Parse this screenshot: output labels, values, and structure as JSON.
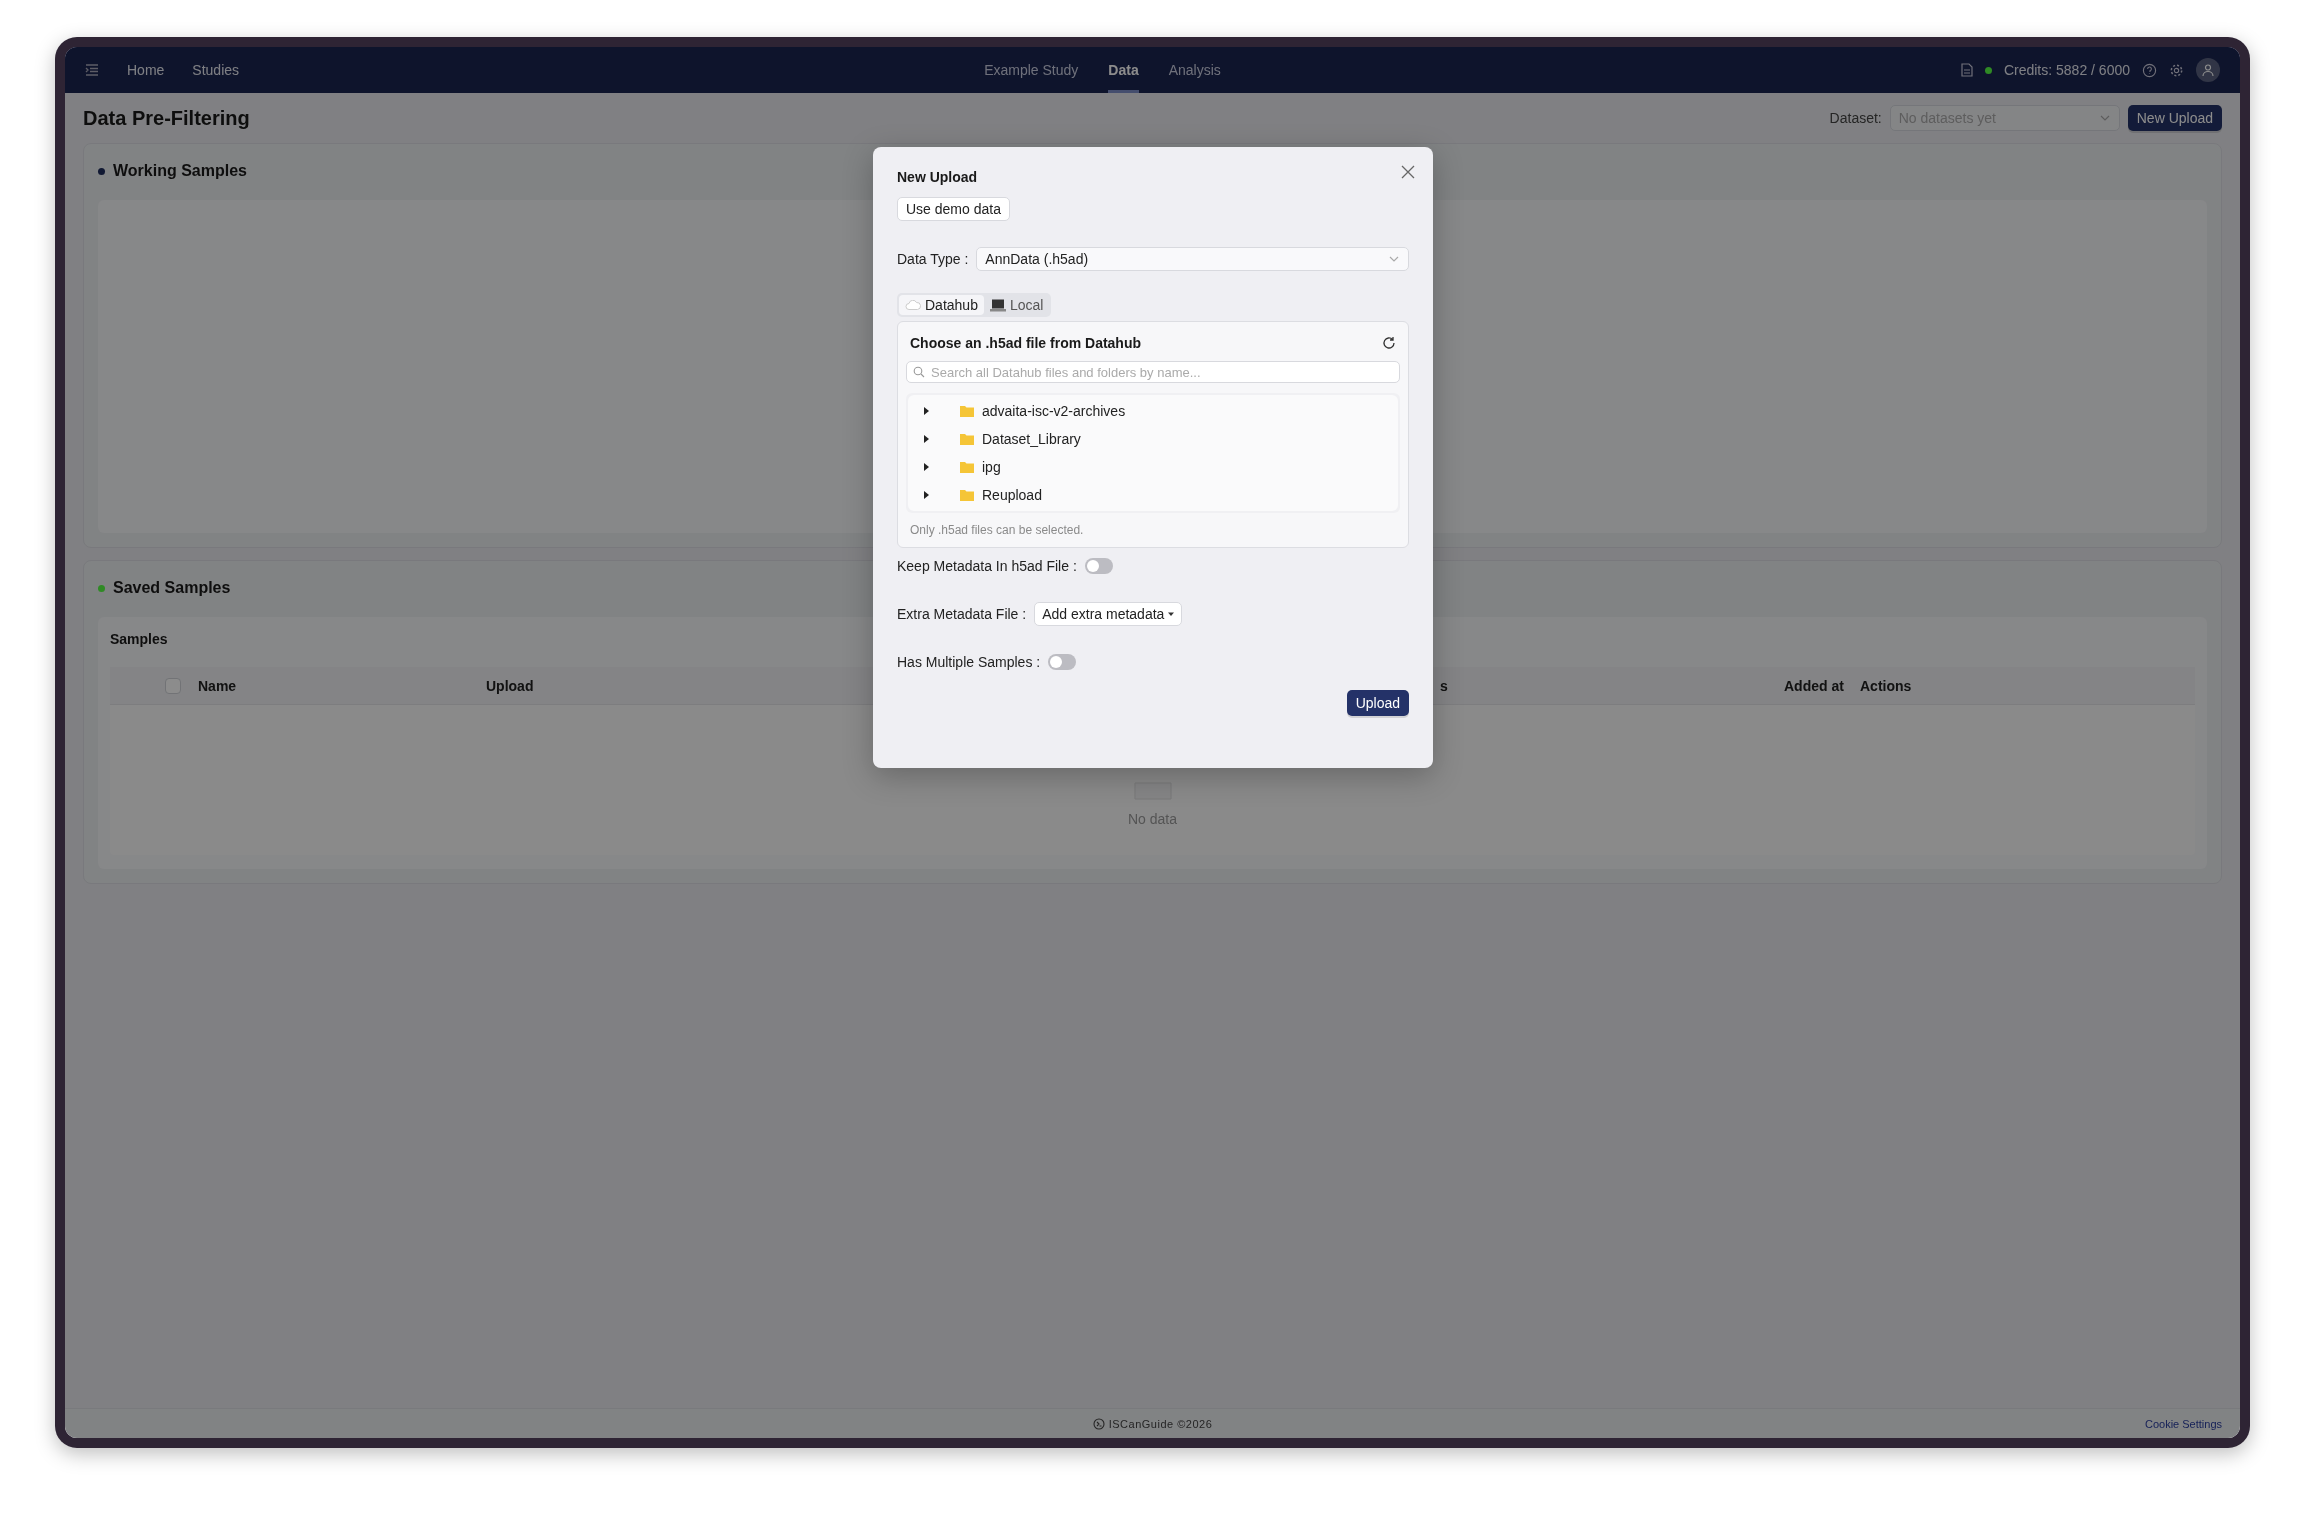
{
  "nav": {
    "left_links": [
      {
        "label": "Home"
      },
      {
        "label": "Studies"
      }
    ],
    "tabs": [
      {
        "label": "Example Study",
        "selected": false
      },
      {
        "label": "Data",
        "selected": true
      },
      {
        "label": "Analysis",
        "selected": false
      }
    ],
    "credits": {
      "text": "Credits: 5882 / 6000",
      "color": "#2f8a25"
    }
  },
  "page": {
    "title": "Data Pre-Filtering",
    "dataset_label": "Dataset:",
    "dataset_placeholder": "No datasets yet",
    "new_upload_button": "New Upload"
  },
  "working_samples": {
    "title": "Working Samples",
    "color": "#111933"
  },
  "saved_samples": {
    "title": "Saved Samples",
    "color": "#2f8a25",
    "card_title": "Samples",
    "select_all_checked": false,
    "columns": [
      {
        "label": "Name"
      },
      {
        "label": "Upload"
      },
      {
        "label": "s"
      },
      {
        "label": "Added at"
      },
      {
        "label": "Actions"
      }
    ],
    "empty_text": "No data"
  },
  "footer": {
    "brand": "ISCanGuide ©2026",
    "link": "Cookie Settings"
  },
  "modal": {
    "title": "New Upload",
    "demo_button": "Use demo data",
    "data_type_label": "Data Type :",
    "data_type_value": "AnnData (.h5ad)",
    "source_tabs": [
      {
        "label": "Datahub",
        "kind": "cloud",
        "selected": true
      },
      {
        "label": "Local",
        "kind": "laptop",
        "selected": false
      }
    ],
    "browser": {
      "title": "Choose an .h5ad file from Datahub",
      "search_placeholder": "Search all Datahub files and folders by name...",
      "items": [
        {
          "name": "advaita-isc-v2-archives",
          "expanded": false
        },
        {
          "name": "Dataset_Library",
          "expanded": false
        },
        {
          "name": "ipg",
          "expanded": false
        },
        {
          "name": "Reupload",
          "expanded": false
        }
      ],
      "hint": "Only .h5ad files can be selected."
    },
    "keep_metadata": {
      "label": "Keep Metadata In h5ad File :",
      "on": false
    },
    "extra_metadata": {
      "label": "Extra Metadata File :",
      "button": "Add extra metadata"
    },
    "multiple_samples": {
      "label": "Has Multiple Samples :",
      "on": false
    },
    "upload_button": "Upload"
  }
}
